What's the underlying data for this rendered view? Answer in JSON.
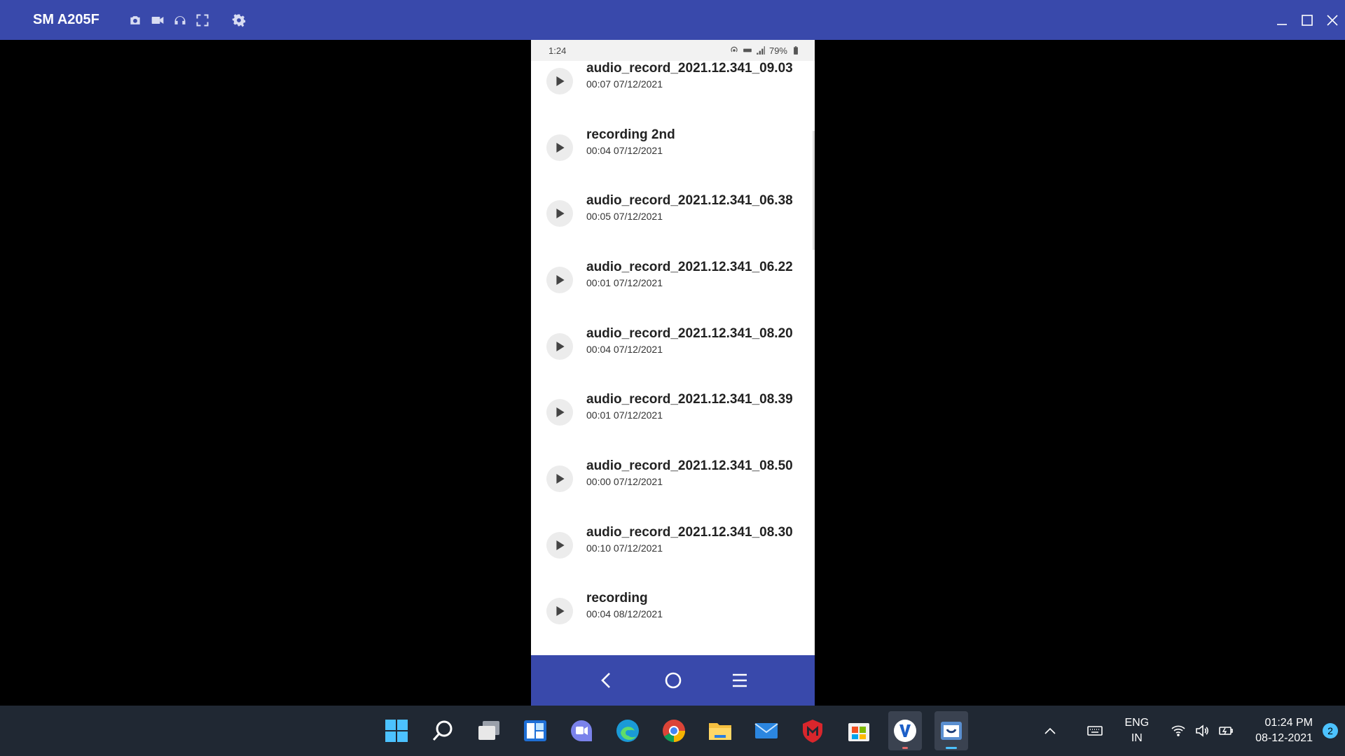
{
  "titlebar": {
    "device_name": "SM A205F",
    "tools": [
      "camera-icon",
      "video-icon",
      "headphones-icon",
      "fullscreen-icon",
      "settings-gear-icon"
    ],
    "window_controls": [
      "minimize-icon",
      "maximize-icon",
      "close-icon"
    ]
  },
  "phone": {
    "status_bar": {
      "time": "1:24",
      "battery": "79%"
    },
    "recordings": [
      {
        "name": "audio_record_2021.12.341_09.03",
        "meta": "00:07 07/12/2021"
      },
      {
        "name": "recording 2nd",
        "meta": "00:04 07/12/2021"
      },
      {
        "name": "audio_record_2021.12.341_06.38",
        "meta": "00:05 07/12/2021"
      },
      {
        "name": "audio_record_2021.12.341_06.22",
        "meta": "00:01 07/12/2021"
      },
      {
        "name": "audio_record_2021.12.341_08.20",
        "meta": "00:04 07/12/2021"
      },
      {
        "name": "audio_record_2021.12.341_08.39",
        "meta": "00:01 07/12/2021"
      },
      {
        "name": "audio_record_2021.12.341_08.50",
        "meta": "00:00 07/12/2021"
      },
      {
        "name": "audio_record_2021.12.341_08.30",
        "meta": "00:10 07/12/2021"
      },
      {
        "name": "recording",
        "meta": "00:04 08/12/2021"
      }
    ]
  },
  "taskbar": {
    "language": {
      "line1": "ENG",
      "line2": "IN"
    },
    "clock": {
      "time": "01:24 PM",
      "date": "08-12-2021"
    },
    "notification_count": "2"
  },
  "colors": {
    "mirror_blue": "#3949ab",
    "taskbar_bg": "#202833",
    "accent": "#4cc2ff"
  }
}
